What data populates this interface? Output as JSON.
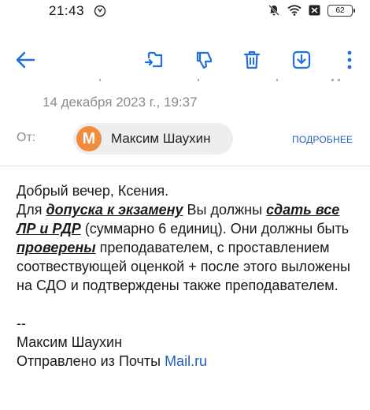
{
  "status_bar": {
    "time": "21:43",
    "battery": "62"
  },
  "toolbar": {
    "icons": [
      "back-arrow-icon",
      "move-icon",
      "spam-icon",
      "trash-icon",
      "download-icon",
      "more-vertical-icon"
    ],
    "accent_color": "#1f6fe0"
  },
  "header": {
    "date": "14 декабря 2023 г., 19:37",
    "from_label": "От:",
    "sender_initial": "М",
    "sender_name": "Максим Шаухин",
    "details_label": "ПОДРОБНЕЕ",
    "avatar_color": "#f28c3c"
  },
  "message": {
    "greeting": "Добрый вечер, Ксения.",
    "p1_a": "Для ",
    "p1_b": "допуска к экзамену",
    "p1_c": " Вы должны ",
    "p1_d": "сдать все ЛР и РДР",
    "p1_e": " (суммарно 6 единиц). Они должны быть ",
    "p1_f": "проверены",
    "p1_g": " преподавателем, с проставлением соотвествующей оценкой + после этого выложены на СДО и подтверждены также преподавателем.",
    "sig_sep": "--",
    "sig_name": "Максим Шаухин",
    "sig_sent": "Отправлено из Почты ",
    "sig_link": "Mail.ru"
  }
}
